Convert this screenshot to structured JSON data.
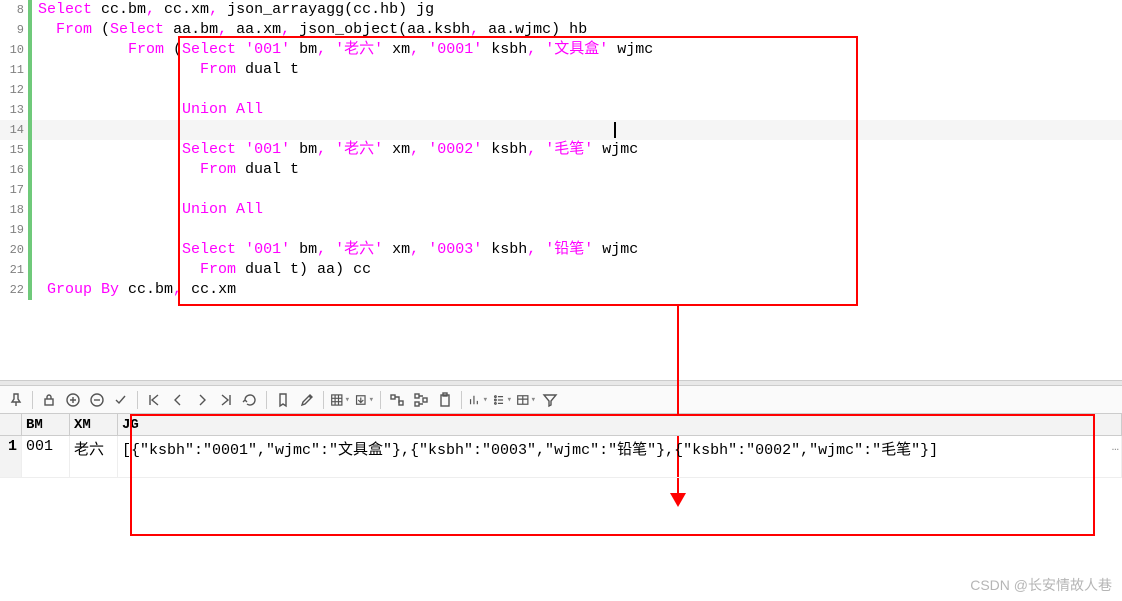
{
  "editor": {
    "lines": [
      {
        "num": 8,
        "tokens": [
          [
            "kw",
            "Select"
          ],
          [
            "plain",
            " cc.bm"
          ],
          [
            "comma",
            ","
          ],
          [
            "plain",
            " cc.xm"
          ],
          [
            "comma",
            ","
          ],
          [
            "plain",
            " json_arrayagg(cc.hb) jg"
          ]
        ]
      },
      {
        "num": 9,
        "tokens": [
          [
            "plain",
            "  "
          ],
          [
            "kw",
            "From"
          ],
          [
            "plain",
            " ("
          ],
          [
            "kw",
            "Select"
          ],
          [
            "plain",
            " aa.bm"
          ],
          [
            "comma",
            ","
          ],
          [
            "plain",
            " aa.xm"
          ],
          [
            "comma",
            ","
          ],
          [
            "plain",
            " json_object(aa.ksbh"
          ],
          [
            "comma",
            ","
          ],
          [
            "plain",
            " aa.wjmc) hb"
          ]
        ]
      },
      {
        "num": 10,
        "tokens": [
          [
            "plain",
            "          "
          ],
          [
            "kw",
            "From"
          ],
          [
            "plain",
            " ("
          ],
          [
            "kw",
            "Select"
          ],
          [
            "plain",
            " "
          ],
          [
            "str",
            "'001'"
          ],
          [
            "plain",
            " bm"
          ],
          [
            "comma",
            ","
          ],
          [
            "plain",
            " "
          ],
          [
            "str",
            "'老六'"
          ],
          [
            "plain",
            " xm"
          ],
          [
            "comma",
            ","
          ],
          [
            "plain",
            " "
          ],
          [
            "str",
            "'0001'"
          ],
          [
            "plain",
            " ksbh"
          ],
          [
            "comma",
            ","
          ],
          [
            "plain",
            " "
          ],
          [
            "str",
            "'文具盒'"
          ],
          [
            "plain",
            " wjmc"
          ]
        ]
      },
      {
        "num": 11,
        "tokens": [
          [
            "plain",
            "                  "
          ],
          [
            "kw",
            "From"
          ],
          [
            "plain",
            " dual t"
          ]
        ]
      },
      {
        "num": 12,
        "tokens": [
          [
            "plain",
            ""
          ]
        ]
      },
      {
        "num": 13,
        "tokens": [
          [
            "plain",
            "                "
          ],
          [
            "kw",
            "Union All"
          ]
        ]
      },
      {
        "num": 14,
        "tokens": [
          [
            "plain",
            ""
          ]
        ],
        "current": true,
        "cursor_at": 64
      },
      {
        "num": 15,
        "tokens": [
          [
            "plain",
            "                "
          ],
          [
            "kw",
            "Select"
          ],
          [
            "plain",
            " "
          ],
          [
            "str",
            "'001'"
          ],
          [
            "plain",
            " bm"
          ],
          [
            "comma",
            ","
          ],
          [
            "plain",
            " "
          ],
          [
            "str",
            "'老六'"
          ],
          [
            "plain",
            " xm"
          ],
          [
            "comma",
            ","
          ],
          [
            "plain",
            " "
          ],
          [
            "str",
            "'0002'"
          ],
          [
            "plain",
            " ksbh"
          ],
          [
            "comma",
            ","
          ],
          [
            "plain",
            " "
          ],
          [
            "str",
            "'毛笔'"
          ],
          [
            "plain",
            " wjmc"
          ]
        ]
      },
      {
        "num": 16,
        "tokens": [
          [
            "plain",
            "                  "
          ],
          [
            "kw",
            "From"
          ],
          [
            "plain",
            " dual t"
          ]
        ]
      },
      {
        "num": 17,
        "tokens": [
          [
            "plain",
            ""
          ]
        ]
      },
      {
        "num": 18,
        "tokens": [
          [
            "plain",
            "                "
          ],
          [
            "kw",
            "Union All"
          ]
        ]
      },
      {
        "num": 19,
        "tokens": [
          [
            "plain",
            ""
          ]
        ]
      },
      {
        "num": 20,
        "tokens": [
          [
            "plain",
            "                "
          ],
          [
            "kw",
            "Select"
          ],
          [
            "plain",
            " "
          ],
          [
            "str",
            "'001'"
          ],
          [
            "plain",
            " bm"
          ],
          [
            "comma",
            ","
          ],
          [
            "plain",
            " "
          ],
          [
            "str",
            "'老六'"
          ],
          [
            "plain",
            " xm"
          ],
          [
            "comma",
            ","
          ],
          [
            "plain",
            " "
          ],
          [
            "str",
            "'0003'"
          ],
          [
            "plain",
            " ksbh"
          ],
          [
            "comma",
            ","
          ],
          [
            "plain",
            " "
          ],
          [
            "str",
            "'铅笔'"
          ],
          [
            "plain",
            " wjmc"
          ]
        ]
      },
      {
        "num": 21,
        "tokens": [
          [
            "plain",
            "                  "
          ],
          [
            "kw",
            "From"
          ],
          [
            "plain",
            " dual t) aa) cc"
          ]
        ]
      },
      {
        "num": 22,
        "tokens": [
          [
            "plain",
            " "
          ],
          [
            "kw",
            "Group By"
          ],
          [
            "plain",
            " cc.bm"
          ],
          [
            "comma",
            ","
          ],
          [
            "plain",
            " cc.xm"
          ]
        ]
      }
    ]
  },
  "toolbar": {
    "buttons": [
      "pin",
      "lock",
      "add",
      "remove",
      "check",
      "first",
      "prev",
      "next",
      "last",
      "refresh",
      "bookmark",
      "edit",
      "grid",
      "export",
      "link",
      "related",
      "clipboard",
      "dataset",
      "chart",
      "sort",
      "table",
      "filter"
    ]
  },
  "results": {
    "columns": {
      "rownum": "",
      "bm": "BM",
      "xm": "XM",
      "jg": "JG"
    },
    "rows": [
      {
        "rownum": "1",
        "bm": "001",
        "xm": "老六",
        "jg": "[{\"ksbh\":\"0001\",\"wjmc\":\"文具盒\"},{\"ksbh\":\"0003\",\"wjmc\":\"铅笔\"},{\"ksbh\":\"0002\",\"wjmc\":\"毛笔\"}]",
        "ellipsis": "…"
      }
    ]
  },
  "watermark": "CSDN @长安情故人巷"
}
